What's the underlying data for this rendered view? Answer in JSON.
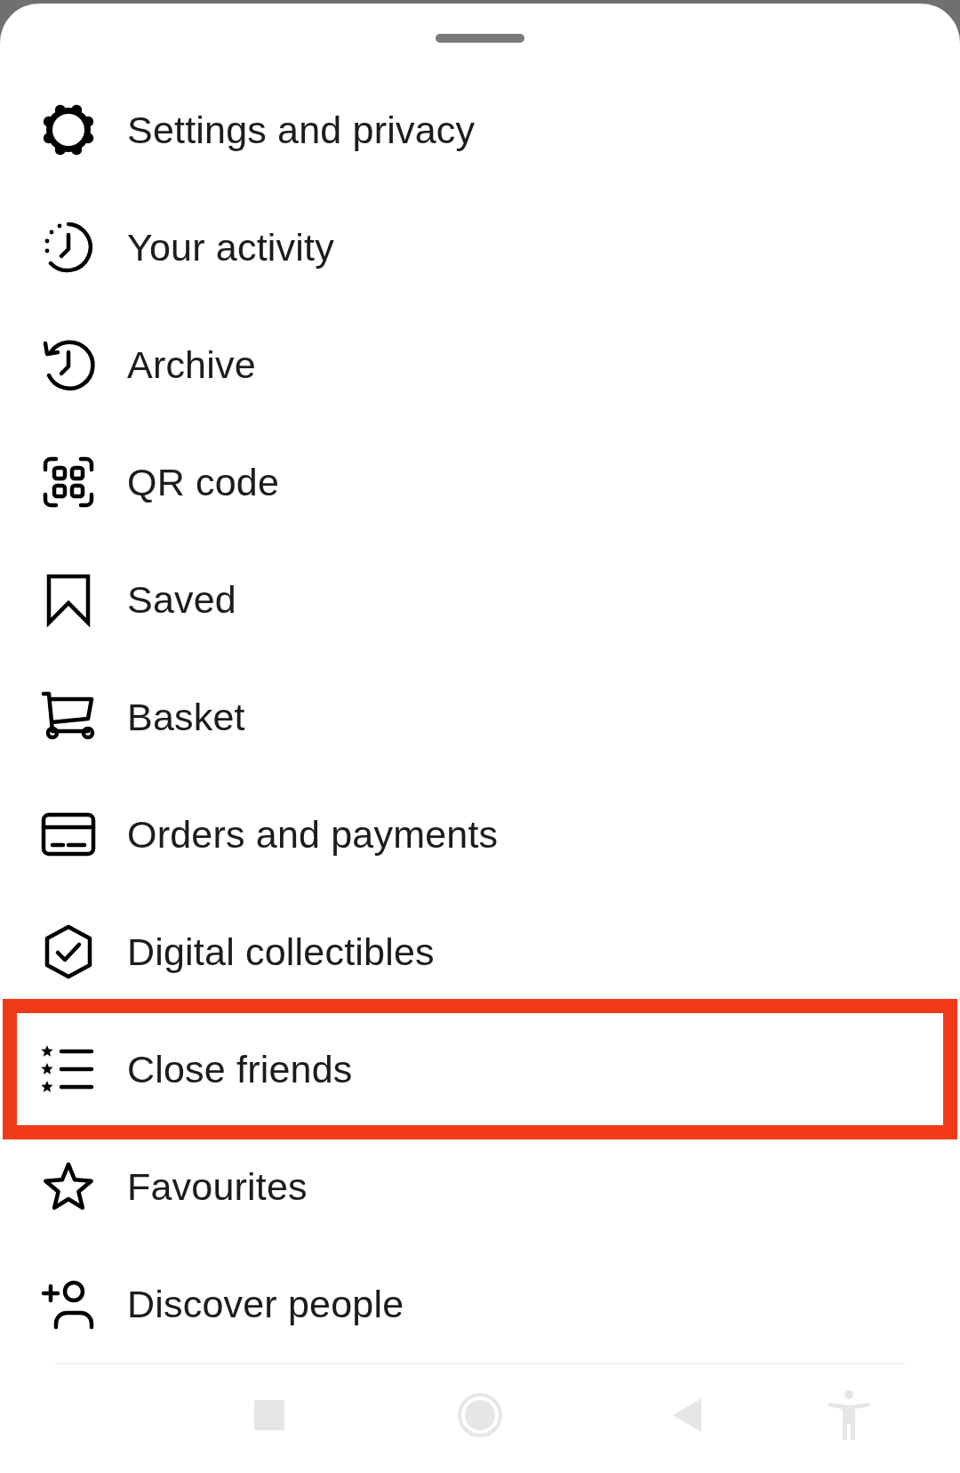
{
  "sheet": {
    "items": [
      {
        "label": "Settings and privacy",
        "kind": "gear",
        "highlighted": false
      },
      {
        "label": "Your activity",
        "kind": "activity",
        "highlighted": false
      },
      {
        "label": "Archive",
        "kind": "archive",
        "highlighted": false
      },
      {
        "label": "QR code",
        "kind": "qr",
        "highlighted": false
      },
      {
        "label": "Saved",
        "kind": "bookmark",
        "highlighted": false
      },
      {
        "label": "Basket",
        "kind": "cart",
        "highlighted": false
      },
      {
        "label": "Orders and payments",
        "kind": "card",
        "highlighted": false
      },
      {
        "label": "Digital collectibles",
        "kind": "badge",
        "highlighted": false
      },
      {
        "label": "Close friends",
        "kind": "starlist",
        "highlighted": true
      },
      {
        "label": "Favourites",
        "kind": "star",
        "highlighted": false
      },
      {
        "label": "Discover people",
        "kind": "adduser",
        "highlighted": false
      }
    ]
  },
  "nav_bar": {
    "buttons": [
      {
        "kind": "recents"
      },
      {
        "kind": "home"
      },
      {
        "kind": "back"
      },
      {
        "kind": "accessibility"
      }
    ]
  }
}
